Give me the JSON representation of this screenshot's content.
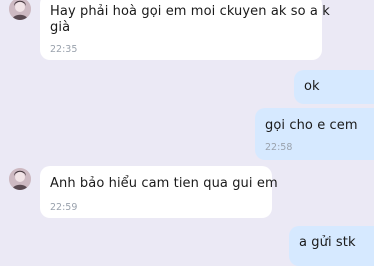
{
  "messages": [
    {
      "direction": "incoming",
      "lines": [
        "Hay phải hoà gọi em moi ckuyen ak so a k",
        "già"
      ],
      "time": "22:35",
      "has_avatar": true
    },
    {
      "direction": "outgoing",
      "text": "ok"
    },
    {
      "direction": "outgoing",
      "text": "gọi cho e cem",
      "time": "22:58"
    },
    {
      "direction": "incoming",
      "text": "Anh bảo hiểu cam tien qua gui em",
      "time": "22:59",
      "has_avatar": true
    },
    {
      "direction": "outgoing",
      "text": "a gửi stk"
    }
  ],
  "colors": {
    "background": "#ebe9f5",
    "incoming_bubble": "#ffffff",
    "outgoing_bubble": "#d6e9ff",
    "timestamp": "#9aa2ad"
  },
  "icons": {
    "avatar": "contact-avatar-icon"
  }
}
